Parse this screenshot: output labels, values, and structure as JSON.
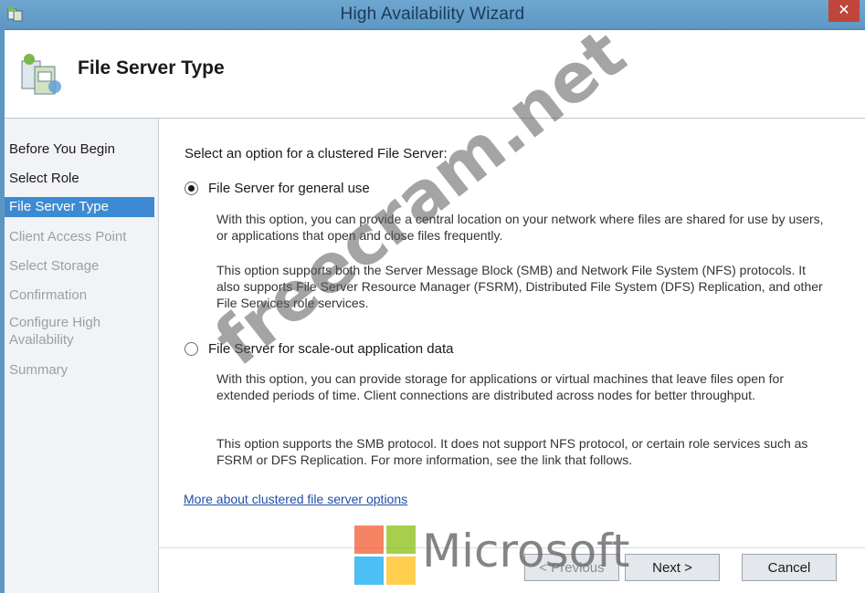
{
  "window": {
    "title": "High Availability Wizard",
    "close_glyph": "✕"
  },
  "header": {
    "page_title": "File Server Type"
  },
  "nav": {
    "items": [
      {
        "label": "Before You Begin",
        "state": "done"
      },
      {
        "label": "Select Role",
        "state": "done"
      },
      {
        "label": "File Server Type",
        "state": "current"
      },
      {
        "label": "Client Access Point",
        "state": "pending"
      },
      {
        "label": "Select Storage",
        "state": "pending"
      },
      {
        "label": "Confirmation",
        "state": "pending"
      },
      {
        "label": "Configure High Availability",
        "state": "pending"
      },
      {
        "label": "Summary",
        "state": "pending"
      }
    ]
  },
  "main": {
    "prompt": "Select an option for a clustered File Server:",
    "options": [
      {
        "label": "File Server for general use",
        "selected": true,
        "desc1": "With this option, you can provide a central location on your network where files are shared for use by users, or applications that open and close files frequently.",
        "desc2": "This option supports both the Server Message Block (SMB) and Network File System (NFS) protocols. It also supports File Server Resource Manager (FSRM), Distributed File System (DFS) Replication, and other File Services role services."
      },
      {
        "label": "File Server for scale-out application data",
        "selected": false,
        "desc1": "With this option, you can provide storage for applications or virtual machines that leave files open for extended periods of time. Client connections are distributed across nodes for better throughput.",
        "desc2": "This option supports the SMB protocol. It does not support NFS protocol, or certain role services such as FSRM or DFS Replication. For more information, see the link that follows."
      }
    ],
    "link": "More about clustered file server options"
  },
  "buttons": {
    "previous": "< Previous",
    "next": "Next >",
    "cancel": "Cancel"
  },
  "watermark": {
    "text": "freecram.net"
  },
  "brand": {
    "text": "Microsoft",
    "colors": [
      "#f25022",
      "#7fba00",
      "#00a4ef",
      "#ffb900"
    ]
  },
  "colors": {
    "titlebar": "#5c97c4",
    "nav_selected": "#3d8ad3",
    "link": "#1f4ea8"
  }
}
